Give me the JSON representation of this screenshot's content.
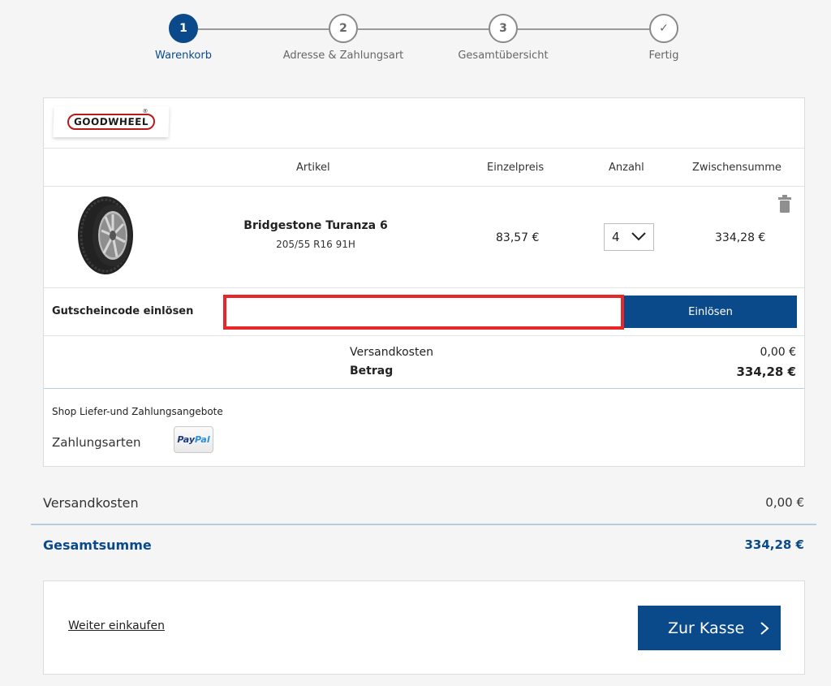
{
  "stepper": {
    "steps": [
      {
        "number": "1",
        "label": "Warenkorb",
        "active": true
      },
      {
        "number": "2",
        "label": "Adresse & Zahlungsart",
        "active": false
      },
      {
        "number": "3",
        "label": "Gesamtübersicht",
        "active": false
      },
      {
        "number": "✓",
        "label": "Fertig",
        "active": false
      }
    ]
  },
  "shop": {
    "logo_text": "GOODWHEEL",
    "logo_mark": "®"
  },
  "table": {
    "headers": {
      "article": "Artikel",
      "unit_price": "Einzelpreis",
      "quantity": "Anzahl",
      "subtotal": "Zwischensumme"
    }
  },
  "item": {
    "name": "Bridgestone Turanza 6",
    "size": "205/55 R16 91H",
    "unit_price": "83,57 €",
    "quantity": "4",
    "subtotal": "334,28 €",
    "image_icon": "tire-icon",
    "delete_icon": "trash-icon"
  },
  "coupon": {
    "label": "Gutscheincode einlösen",
    "value": "",
    "button_label": "Einlösen"
  },
  "totals": {
    "shipping_label": "Versandkosten",
    "shipping_value": "0,00 €",
    "amount_label": "Betrag",
    "amount_value": "334,28 €"
  },
  "payment": {
    "title": "Shop Liefer-und Zahlungsangebote",
    "methods_label": "Zahlungsarten",
    "paypal_a": "Pay",
    "paypal_b": "Pal"
  },
  "summary": {
    "shipping_label": "Versandkosten",
    "shipping_value": "0,00 €",
    "total_label": "Gesamtsumme",
    "total_value": "334,28 €"
  },
  "footer": {
    "continue_label": "Weiter einkaufen",
    "checkout_label": "Zur Kasse"
  },
  "colors": {
    "primary": "#0b4a8a",
    "highlight": "#e8272b"
  }
}
